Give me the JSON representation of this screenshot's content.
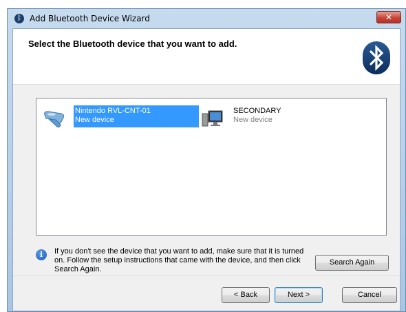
{
  "window": {
    "title": "Add Bluetooth Device Wizard",
    "close_label": "✕"
  },
  "header": {
    "instruction": "Select the Bluetooth device that you want to add.",
    "logo_icon": "bluetooth-icon"
  },
  "devices": [
    {
      "name": "Nintendo RVL-CNT-01",
      "status": "New device",
      "icon": "gamepad-icon",
      "selected": true
    },
    {
      "name": "SECONDARY",
      "status": "New device",
      "icon": "computer-icon",
      "selected": false
    }
  ],
  "info": {
    "text": "If you don't see the device that you want to add, make sure that it is turned on. Follow the setup instructions that came with the device, and then click Search Again.",
    "icon": "info-icon"
  },
  "buttons": {
    "search_again": "Search Again",
    "back": "< Back",
    "next": "Next >",
    "cancel": "Cancel"
  },
  "colors": {
    "selection": "#3399ff",
    "close_button": "#c9453a"
  }
}
